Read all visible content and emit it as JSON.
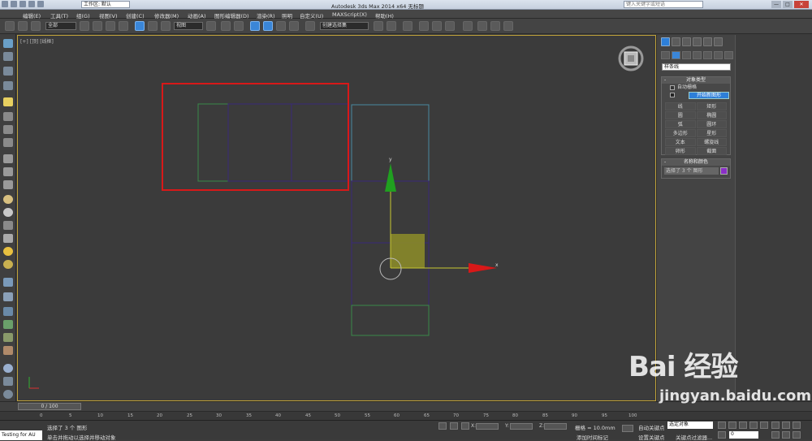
{
  "titlebar": {
    "workspace": "工作区: 默认",
    "title": "Autodesk 3ds Max  2014 x64    无标题",
    "search_placeholder": "键入关键字或短语",
    "win_buttons": [
      "—",
      "□",
      "✕"
    ]
  },
  "menu": [
    "编辑(E)",
    "工具(T)",
    "组(G)",
    "视图(V)",
    "创建(C)",
    "修改器(M)",
    "动画(A)",
    "图形编辑器(D)",
    "渲染(R)",
    "照明",
    "自定义(U)",
    "MAXScript(X)",
    "帮助(H)"
  ],
  "toolbar": {
    "filter": "全部",
    "refcoord": "视图",
    "selset": "创建选择集"
  },
  "viewport": {
    "label": "[+] [顶] [线框]",
    "axis_x": "x",
    "axis_y": "y"
  },
  "cmd": {
    "category": "样条线",
    "obj_type_title": "对象类型",
    "autogrid": "自动栅格",
    "start_new": "开始新图形",
    "buttons": [
      "线",
      "矩形",
      "圆",
      "椭圆",
      "弧",
      "圆环",
      "多边形",
      "星形",
      "文本",
      "螺旋线",
      "卵形",
      "截面"
    ],
    "name_color_title": "名称和颜色",
    "name_value": "选择了 3 个 图形",
    "color": "#8a2fc6"
  },
  "timeline": {
    "slider": "0 / 100",
    "ticks": [
      "0",
      "5",
      "10",
      "15",
      "20",
      "25",
      "30",
      "35",
      "40",
      "45",
      "50",
      "55",
      "60",
      "65",
      "70",
      "75",
      "80",
      "85",
      "90",
      "95",
      "100"
    ]
  },
  "status": {
    "maxscript": "Testing for AU",
    "selected": "选择了 3 个 图形",
    "prompt": "单击并拖动以选择并移动对象",
    "x_label": "X:",
    "y_label": "Y:",
    "z_label": "Z:",
    "grid": "栅格 = 10.0mm",
    "add_tag": "添加时间标记",
    "autokey": "自动关键点",
    "setkey": "设置关键点",
    "key_mode": "选定对象",
    "key_filters": "关键点过滤器...",
    "frame": "0"
  },
  "watermark": {
    "logo": "Bai 经验",
    "url": "jingyan.baidu.com"
  }
}
